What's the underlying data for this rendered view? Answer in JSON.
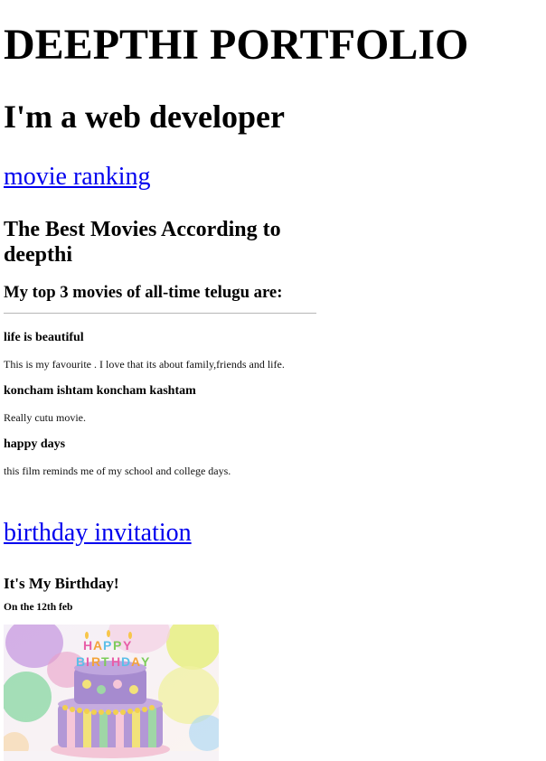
{
  "header": {
    "title": "DEEPTHI PORTFOLIO",
    "subtitle": "I'm a web developer"
  },
  "links": {
    "movie_ranking": "movie ranking",
    "birthday_invitation": "birthday invitation"
  },
  "movies": {
    "heading": "The Best Movies According to deepthi",
    "subheading": "My top 3 movies of all-time telugu are:",
    "items": [
      {
        "title": "life is beautiful",
        "description": "This is my favourite . I love that its about family,friends and life."
      },
      {
        "title": "koncham ishtam koncham kashtam",
        "description": "Really cutu movie."
      },
      {
        "title": "happy days",
        "description": "this film reminds me of my school and college days."
      }
    ]
  },
  "birthday": {
    "heading": "It's My Birthday!",
    "date": "On the 12th feb",
    "image_text": "HAPPY BIRTHDAY"
  },
  "colors": {
    "link": "#0000ee",
    "text": "#000000",
    "rule": "#b7b7b7"
  }
}
